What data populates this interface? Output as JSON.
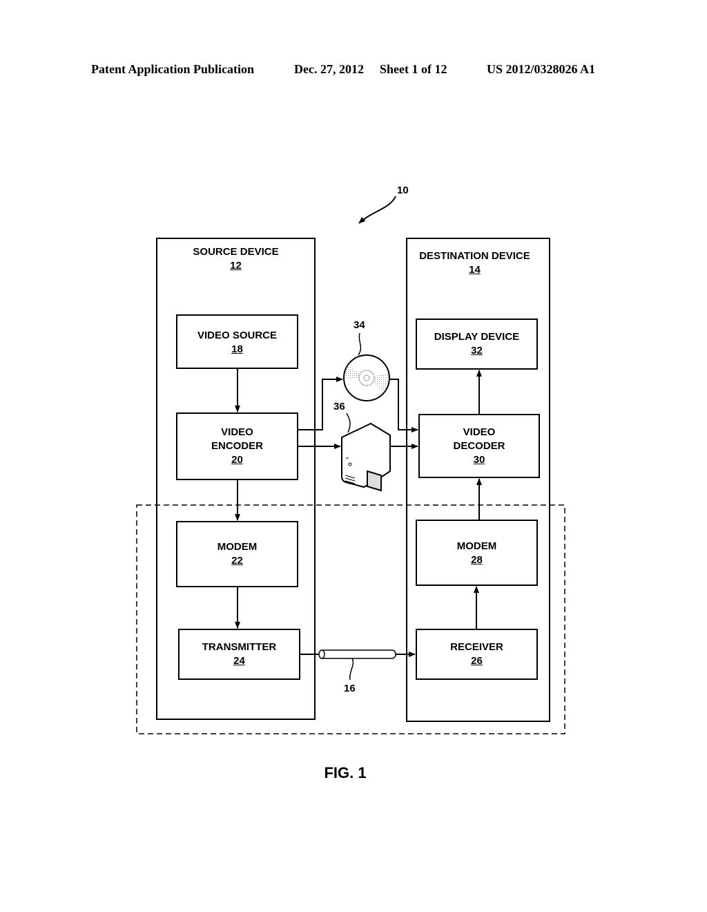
{
  "header": {
    "publication": "Patent Application Publication",
    "date": "Dec. 27, 2012",
    "sheet": "Sheet 1 of 12",
    "number": "US 2012/0328026 A1"
  },
  "figure": {
    "caption": "FIG. 1",
    "system_ref": "10",
    "source_device": {
      "label": "SOURCE DEVICE",
      "ref": "12"
    },
    "destination_device": {
      "label": "DESTINATION DEVICE",
      "ref": "14"
    },
    "blocks": {
      "video_source": {
        "l1": "VIDEO SOURCE",
        "ref": "18"
      },
      "video_encoder": {
        "l1": "VIDEO",
        "l2": "ENCODER",
        "ref": "20"
      },
      "modem_src": {
        "l1": "MODEM",
        "ref": "22"
      },
      "transmitter": {
        "l1": "TRANSMITTER",
        "ref": "24"
      },
      "display_device": {
        "l1": "DISPLAY DEVICE",
        "ref": "32"
      },
      "video_decoder": {
        "l1": "VIDEO",
        "l2": "DECODER",
        "ref": "30"
      },
      "modem_dst": {
        "l1": "MODEM",
        "ref": "28"
      },
      "receiver": {
        "l1": "RECEIVER",
        "ref": "26"
      }
    },
    "storage_medium_ref": "34",
    "file_server_ref": "36",
    "channel_ref": "16"
  }
}
